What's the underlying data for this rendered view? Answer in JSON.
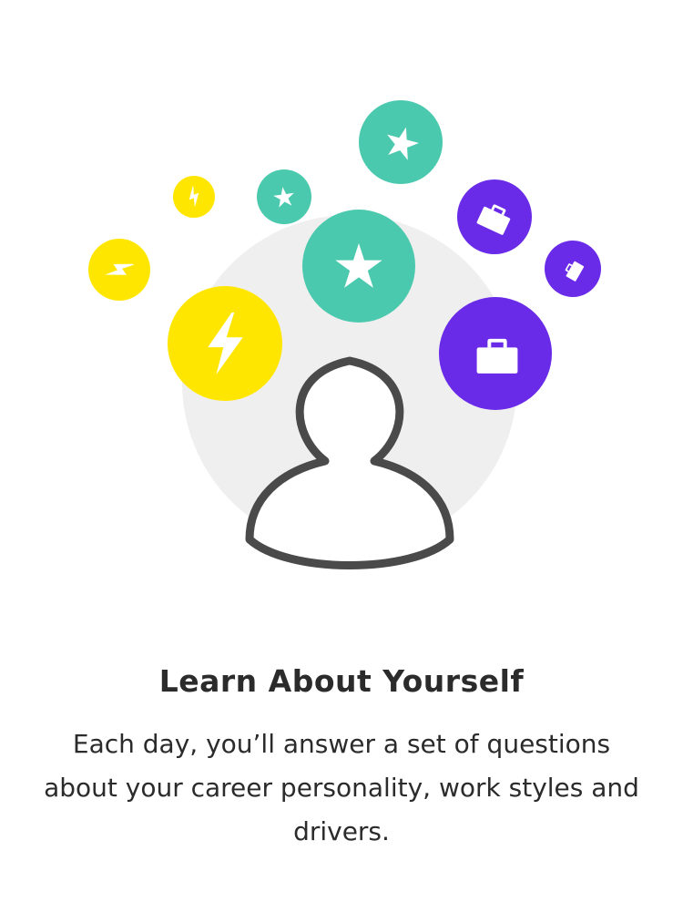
{
  "screen": {
    "title": "Learn About Yourself",
    "description": "Each day, you’ll answer a set of questions about your career personality, work styles and drivers."
  },
  "illustration": {
    "icons": [
      "person-icon",
      "lightning-icon",
      "star-icon",
      "briefcase-icon"
    ],
    "colors": {
      "yellow": "#FFE600",
      "teal": "#4BC9AE",
      "purple": "#6A2BE8",
      "background_circle": "#EFEFEF",
      "person_outline": "#4A4A4A"
    }
  }
}
